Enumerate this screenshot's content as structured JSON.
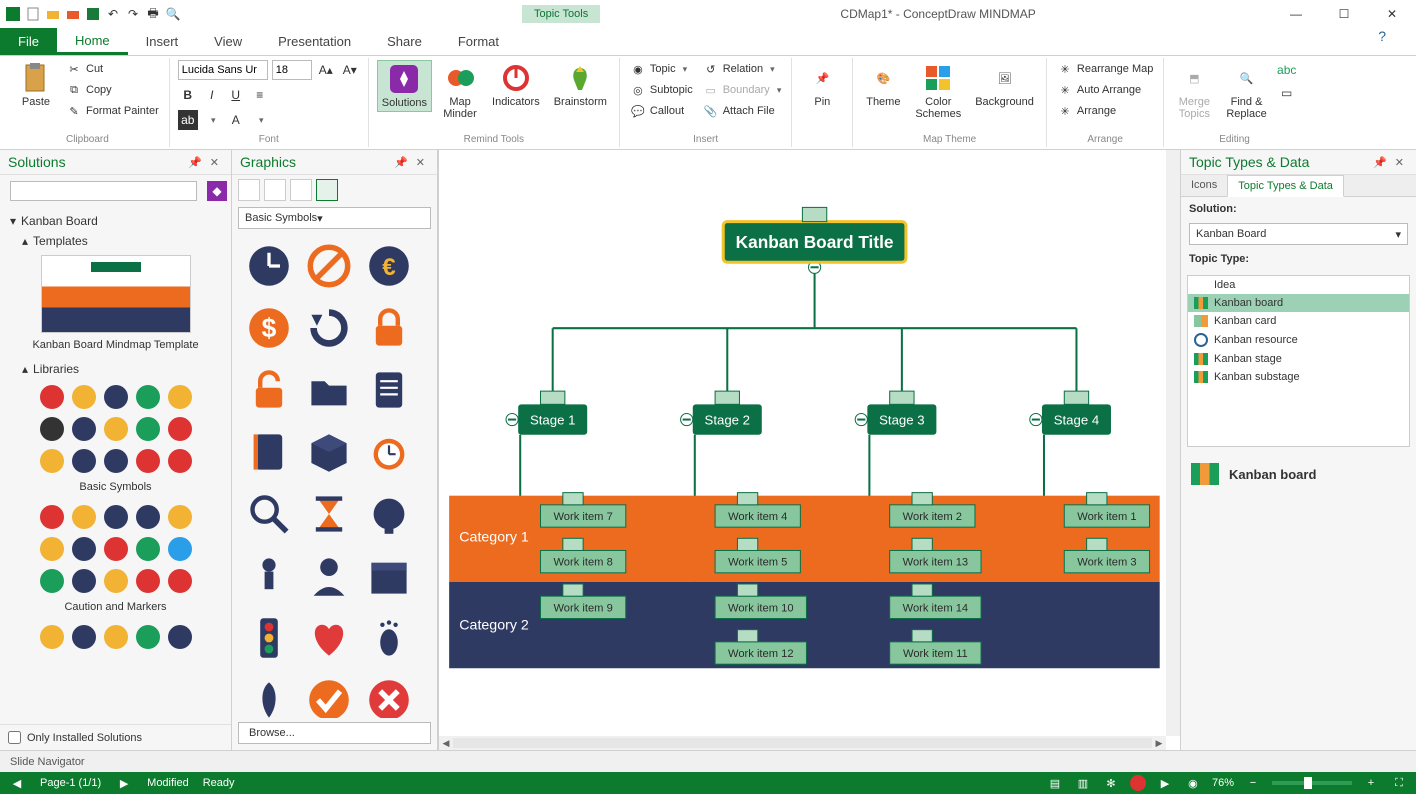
{
  "title": {
    "context_tab": "Topic Tools",
    "document": "CDMap1* - ConceptDraw MINDMAP"
  },
  "quick_access": [
    "app",
    "new",
    "open",
    "close",
    "save",
    "undo",
    "redo",
    "print",
    "preview"
  ],
  "tabs": {
    "file": "File",
    "active": "Home",
    "items": [
      "Home",
      "Insert",
      "View",
      "Presentation",
      "Share",
      "Format"
    ]
  },
  "ribbon": {
    "clipboard": {
      "paste": "Paste",
      "cut": "Cut",
      "copy": "Copy",
      "format_painter": "Format Painter",
      "label": "Clipboard"
    },
    "font": {
      "family": "Lucida Sans Ur",
      "size": "18",
      "label": "Font"
    },
    "remind": {
      "solutions": "Solutions",
      "map_minder": "Map\nMinder",
      "indicators": "Indicators",
      "brainstorm": "Brainstorm",
      "label": "Remind Tools"
    },
    "insert": {
      "topic": "Topic",
      "subtopic": "Subtopic",
      "callout": "Callout",
      "relation": "Relation",
      "boundary": "Boundary",
      "attach_file": "Attach File",
      "label": "Insert"
    },
    "pin": {
      "label": "Pin"
    },
    "map_theme": {
      "theme": "Theme",
      "color_schemes": "Color\nSchemes",
      "background": "Background",
      "label": "Map Theme"
    },
    "arrange": {
      "rearrange": "Rearrange Map",
      "auto": "Auto Arrange",
      "arrange": "Arrange",
      "label": "Arrange"
    },
    "editing": {
      "merge": "Merge\nTopics",
      "find": "Find &\nReplace",
      "label": "Editing"
    }
  },
  "solutions_panel": {
    "title": "Solutions",
    "root": "Kanban Board",
    "templates_label": "Templates",
    "template_caption": "Kanban Board Mindmap Template",
    "libraries_label": "Libraries",
    "lib1": "Basic Symbols",
    "lib2": "Caution and Markers",
    "only_installed": "Only Installed Solutions"
  },
  "graphics_panel": {
    "title": "Graphics",
    "dropdown": "Basic Symbols",
    "browse": "Browse..."
  },
  "canvas": {
    "title": "Kanban Board Title",
    "stages": [
      "Stage 1",
      "Stage 2",
      "Stage 3",
      "Stage 4"
    ],
    "categories": [
      "Category 1",
      "Category 2"
    ],
    "items": {
      "s1": [
        "Work item 7",
        "Work item 8",
        "Work item 9"
      ],
      "s2": [
        "Work item 4",
        "Work item 5",
        "Work item 10",
        "Work item 12"
      ],
      "s3": [
        "Work item 2",
        "Work item 13",
        "Work item 14",
        "Work item 11"
      ],
      "s4": [
        "Work item 1",
        "Work item 3"
      ]
    }
  },
  "types_panel": {
    "title": "Topic Types & Data",
    "tabs": {
      "icons": "Icons",
      "types": "Topic Types & Data"
    },
    "solution_label": "Solution:",
    "solution_value": "Kanban Board",
    "type_label": "Topic Type:",
    "types": [
      "Idea",
      "Kanban board",
      "Kanban card",
      "Kanban resource",
      "Kanban stage",
      "Kanban substage"
    ],
    "selected_index": 1,
    "current": "Kanban board"
  },
  "bottom": {
    "slide_nav": "Slide Navigator",
    "page": "Page-1 (1/1)",
    "modified": "Modified",
    "ready": "Ready",
    "zoom": "76%"
  }
}
